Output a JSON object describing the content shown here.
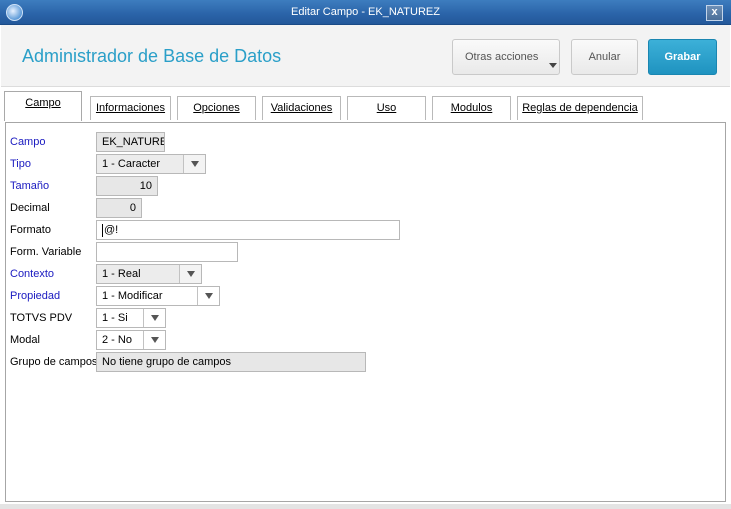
{
  "window": {
    "title": "Editar Campo - EK_NATUREZ",
    "close_label": "x"
  },
  "header": {
    "title": "Administrador de Base de Datos",
    "buttons": {
      "otras": "Otras acciones",
      "anular": "Anular",
      "grabar": "Grabar"
    }
  },
  "tabs": [
    {
      "label": "Campo"
    },
    {
      "label": "Informaciones"
    },
    {
      "label": "Opciones"
    },
    {
      "label": "Validaciones"
    },
    {
      "label": "Uso"
    },
    {
      "label": "Modulos"
    },
    {
      "label": "Reglas de dependencia"
    }
  ],
  "form": {
    "campo": {
      "label": "Campo",
      "value": "EK_NATUREZ"
    },
    "tipo": {
      "label": "Tipo",
      "value": "1 - Caracter"
    },
    "tamano": {
      "label": "Tamaño",
      "value": "10"
    },
    "decimal": {
      "label": "Decimal",
      "value": "0"
    },
    "formato": {
      "label": "Formato",
      "value": "@!"
    },
    "form_variable": {
      "label": "Form. Variable",
      "value": ""
    },
    "contexto": {
      "label": "Contexto",
      "value": "1 - Real"
    },
    "propiedad": {
      "label": "Propiedad",
      "value": "1 - Modificar"
    },
    "totvs_pdv": {
      "label": "TOTVS PDV",
      "value": "1 - Si"
    },
    "modal": {
      "label": "Modal",
      "value": "2 - No"
    },
    "grupo": {
      "label": "Grupo de campos",
      "value": "No tiene grupo de campos"
    }
  },
  "colors": {
    "accent": "#2a9fc8",
    "primary_button": "#1f93c0",
    "required_label": "#1a1ac0",
    "titlebar": "#2a63a8"
  }
}
